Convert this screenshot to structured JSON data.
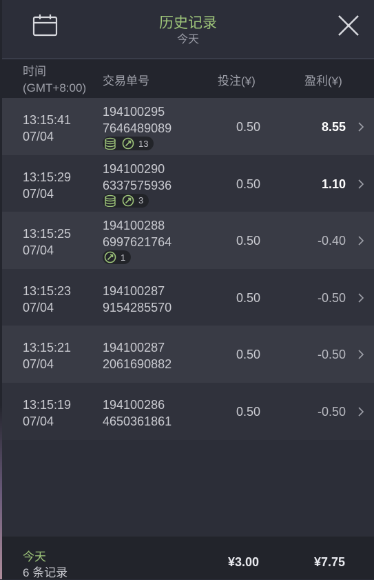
{
  "header": {
    "title": "历史记录",
    "subtitle": "今天",
    "calendar_icon": "calendar-icon",
    "close_icon": "close-icon"
  },
  "columns": {
    "time": "时间",
    "timezone": "(GMT+8:00)",
    "order": "交易单号",
    "stake": "投注(¥)",
    "profit": "盈利(¥)"
  },
  "rows": [
    {
      "time": "13:15:41",
      "date": "07/04",
      "order_a": "194100295",
      "order_b": "7646489089",
      "stake": "0.50",
      "profit": "8.55",
      "coins_icon": true,
      "count": "13"
    },
    {
      "time": "13:15:29",
      "date": "07/04",
      "order_a": "194100290",
      "order_b": "6337575936",
      "stake": "0.50",
      "profit": "1.10",
      "coins_icon": true,
      "count": "3"
    },
    {
      "time": "13:15:25",
      "date": "07/04",
      "order_a": "194100288",
      "order_b": "6997621764",
      "stake": "0.50",
      "profit": "-0.40",
      "coins_icon": false,
      "count": "1"
    },
    {
      "time": "13:15:23",
      "date": "07/04",
      "order_a": "194100287",
      "order_b": "9154285570",
      "stake": "0.50",
      "profit": "-0.50"
    },
    {
      "time": "13:15:21",
      "date": "07/04",
      "order_a": "194100287",
      "order_b": "2061690882",
      "stake": "0.50",
      "profit": "-0.50"
    },
    {
      "time": "13:15:19",
      "date": "07/04",
      "order_a": "194100286",
      "order_b": "4650361861",
      "stake": "0.50",
      "profit": "-0.50"
    }
  ],
  "footer": {
    "period": "今天",
    "count": "6 条记录",
    "total_stake": "¥3.00",
    "total_profit": "¥7.75"
  },
  "colors": {
    "accent_green": "#9ec57a",
    "background": "#2a2c36"
  }
}
